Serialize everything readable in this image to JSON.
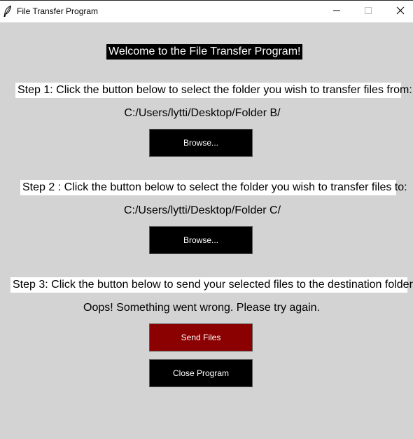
{
  "window": {
    "title": "File Transfer Program"
  },
  "icons": {
    "app": "feather-icon",
    "minimize": "minimize-icon",
    "maximize": "maximize-icon",
    "close": "close-icon"
  },
  "colors": {
    "background": "#d3d3d3",
    "button_bg": "#000000",
    "send_button_bg": "#8b0000",
    "button_text": "#ffffff"
  },
  "main": {
    "welcome": "Welcome to the File Transfer Program!",
    "step1": {
      "label": "Step 1: Click the button below to select the folder you wish to transfer files from:",
      "path": "C:/Users/lytti/Desktop/Folder B/",
      "button": "Browse..."
    },
    "step2": {
      "label": "Step 2 : Click the button below to select the folder you wish to transfer files to:",
      "path": "C:/Users/lytti/Desktop/Folder C/",
      "button": "Browse..."
    },
    "step3": {
      "label": "Step 3: Click the button below to send your selected files to the destination folder:",
      "status": "Oops! Something went wrong. Please try again.",
      "send_button": "Send Files"
    },
    "close_button": "Close Program"
  }
}
